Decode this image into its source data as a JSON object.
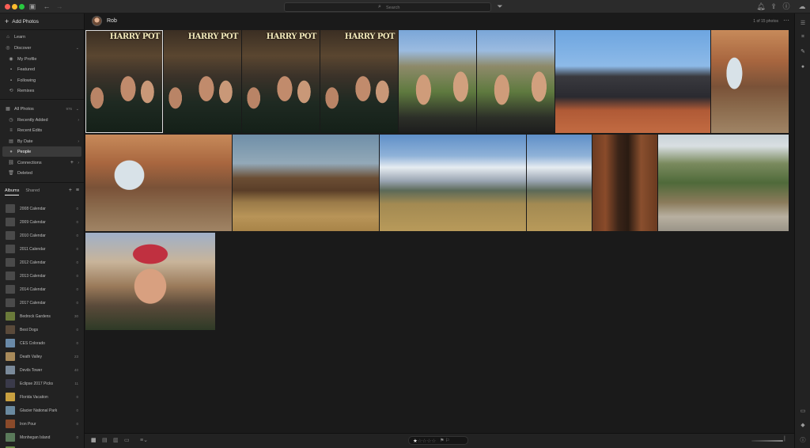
{
  "search": {
    "placeholder": "Search"
  },
  "sidebar": {
    "add_photos": "Add Photos",
    "discover": {
      "label": "Discover",
      "items": [
        {
          "label": "Learn",
          "icon": "graduation-icon"
        },
        {
          "label": "Discover",
          "icon": "compass-icon"
        },
        {
          "label": "My Profile",
          "icon": "user-icon"
        },
        {
          "label": "Featured",
          "icon": "star-icon"
        },
        {
          "label": "Following",
          "icon": "follow-icon"
        },
        {
          "label": "Remixes",
          "icon": "remix-icon"
        }
      ]
    },
    "library": {
      "all_photos": "All Photos",
      "all_photos_count": "976",
      "items": [
        {
          "label": "Recently Added",
          "icon": "clock-icon"
        },
        {
          "label": "Recent Edits",
          "icon": "sliders-icon"
        },
        {
          "label": "By Date",
          "icon": "calendar-icon"
        },
        {
          "label": "People",
          "icon": "person-icon",
          "active": true
        },
        {
          "label": "Connections",
          "icon": "link-icon"
        },
        {
          "label": "Deleted",
          "icon": "trash-icon"
        }
      ]
    },
    "album_tabs": [
      "Albums",
      "Shared"
    ],
    "albums": [
      {
        "name": "2008 Calendar",
        "count": "0",
        "color": "#4a4a4a"
      },
      {
        "name": "2009 Calendar",
        "count": "0",
        "color": "#4a4a4a"
      },
      {
        "name": "2010 Calendar",
        "count": "0",
        "color": "#4a4a4a"
      },
      {
        "name": "2011 Calendar",
        "count": "0",
        "color": "#4a4a4a"
      },
      {
        "name": "2012 Calendar",
        "count": "0",
        "color": "#4a4a4a"
      },
      {
        "name": "2013 Calendar",
        "count": "0",
        "color": "#4a4a4a"
      },
      {
        "name": "2014 Calendar",
        "count": "0",
        "color": "#4a4a4a"
      },
      {
        "name": "2017 Calendar",
        "count": "0",
        "color": "#4a4a4a"
      },
      {
        "name": "Bedrock Gardens",
        "count": "30",
        "color": "#6a7a3a"
      },
      {
        "name": "Best Dogs",
        "count": "0",
        "color": "#5a4a3a"
      },
      {
        "name": "CES Colorado",
        "count": "0",
        "color": "#6a8aa8"
      },
      {
        "name": "Death Valley",
        "count": "23",
        "color": "#a88a5a"
      },
      {
        "name": "Devils Tower",
        "count": "40",
        "color": "#7a8a9a"
      },
      {
        "name": "Eclipse 2017 Picks",
        "count": "11",
        "color": "#3a3a4a"
      },
      {
        "name": "Florida Vacation",
        "count": "0",
        "color": "#c8a040"
      },
      {
        "name": "Glacier National Park",
        "count": "0",
        "color": "#6a8aa0"
      },
      {
        "name": "Iron Pour",
        "count": "0",
        "color": "#8a4a2a"
      },
      {
        "name": "Monhegan Island",
        "count": "0",
        "color": "#5a7a5a"
      },
      {
        "name": "National Parks",
        "count": "0",
        "color": "#6a8a4a"
      }
    ]
  },
  "person": {
    "name": "Rob",
    "photo_count": "1 of 15 photos"
  },
  "photos": [
    {
      "name": "harry-potter-selfie-1"
    },
    {
      "name": "harry-potter-selfie-2"
    },
    {
      "name": "harry-potter-selfie-3"
    },
    {
      "name": "harry-potter-selfie-4"
    },
    {
      "name": "devils-tower-selfie-1"
    },
    {
      "name": "devils-tower-selfie-2"
    },
    {
      "name": "group-photo-desert"
    },
    {
      "name": "man-with-rock-formation"
    },
    {
      "name": "mesa-arch-group"
    },
    {
      "name": "moulton-barn-photographer"
    },
    {
      "name": "grand-teton-barn-wide"
    },
    {
      "name": "grand-teton-barn-tall"
    },
    {
      "name": "redwood-tree-tunnel"
    },
    {
      "name": "yellowstone-canyon-portrait"
    },
    {
      "name": "desert-selfie-red-cap"
    }
  ],
  "rating": {
    "stars": 1,
    "max": 5
  },
  "colors": {
    "accent": "#e8e8e8",
    "bg": "#1a1a1a",
    "sidebar": "#222222"
  }
}
